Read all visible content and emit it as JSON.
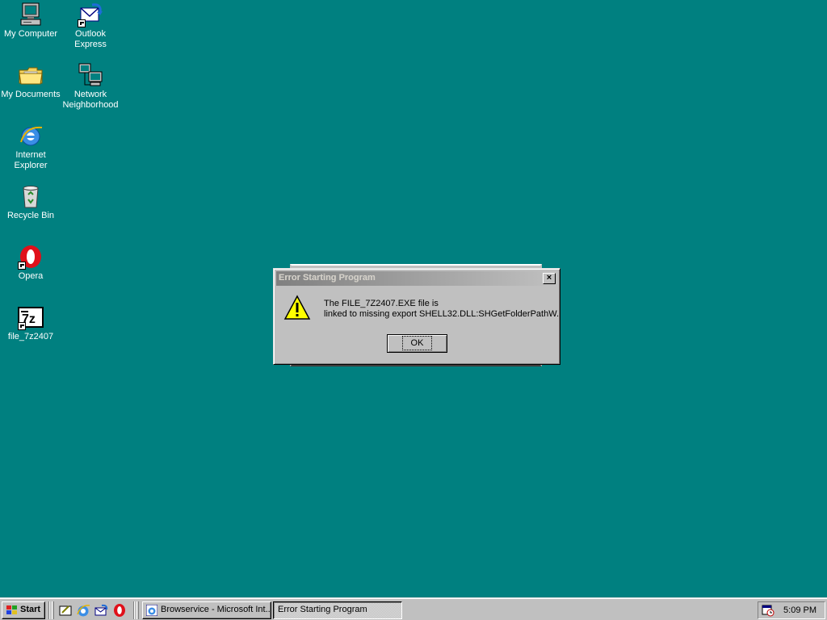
{
  "desktop": {
    "background": "#008080",
    "icons": [
      {
        "name": "My Computer",
        "icon": "computer-icon"
      },
      {
        "name": "Outlook\nExpress",
        "icon": "outlook-express-icon"
      },
      {
        "name": "My Documents",
        "icon": "folder-icon"
      },
      {
        "name": "Network\nNeighborhood",
        "icon": "network-icon"
      },
      {
        "name": "Internet\nExplorer",
        "icon": "internet-explorer-icon"
      },
      {
        "name": "Recycle Bin",
        "icon": "recycle-bin-icon"
      },
      {
        "name": "Opera",
        "icon": "opera-icon"
      },
      {
        "name": "file_7z2407",
        "icon": "7zip-icon"
      }
    ]
  },
  "dialog": {
    "title": "Error Starting Program",
    "close_label": "×",
    "message_line1": "The FILE_7Z2407.EXE file is",
    "message_line2": "linked to missing export SHELL32.DLL:SHGetFolderPathW.",
    "ok_label": "OK",
    "icon": "warning-icon"
  },
  "taskbar": {
    "start_label": "Start",
    "tasks": [
      {
        "label": "Browservice - Microsoft Int...",
        "icon": "internet-explorer-icon",
        "active": false
      },
      {
        "label": "Error Starting Program",
        "icon": "",
        "active": true
      }
    ],
    "clock": "5:09 PM"
  }
}
